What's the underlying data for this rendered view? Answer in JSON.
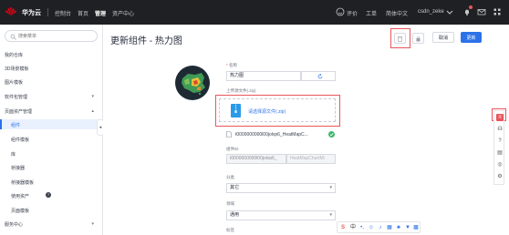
{
  "topbar": {
    "brand": "华为云",
    "nav": [
      "控制台",
      "首页",
      "管理",
      "资产中心"
    ],
    "right": [
      "评价",
      "工单",
      "简体中文",
      "csdn_zeke"
    ],
    "colors": {
      "bg": "#1f2023",
      "logo": "#e60012"
    }
  },
  "sidebar": {
    "search_placeholder": "搜索菜单",
    "items": [
      {
        "label": "我的仓库"
      },
      {
        "label": "3D场景模板"
      },
      {
        "label": "图片模板"
      },
      {
        "label": "软件包管理"
      },
      {
        "label": "页面资产管理"
      },
      {
        "label": "组件"
      },
      {
        "label": "组件模板"
      },
      {
        "label": "库"
      },
      {
        "label": "桥接器"
      },
      {
        "label": "桥接器模板"
      },
      {
        "label": "使用资产"
      },
      {
        "label": "页面模板"
      },
      {
        "label": "服务中心"
      }
    ]
  },
  "main": {
    "title": "更新组件 - 热力图",
    "buttons": {
      "cancel": "取消",
      "update": "更新"
    },
    "form": {
      "name_label": "名称",
      "name_value": "热力图",
      "upload_label": "上传源文件(.zip)",
      "upload_text": "请选择源文件(.zip)",
      "file_name": "t0000000000l00jolvp6_HeatMapC...",
      "id_label": "组件ID",
      "id_value": "t0000000000l00jolvp6_",
      "id_suffix": "HeatMapChartMi",
      "category_label": "分类",
      "category_value": "其它",
      "domain_label": "领域",
      "domain_value": "通用",
      "tags_label": "标签"
    }
  },
  "colors": {
    "accent": "#2b72e8",
    "highlight": "#e8565c"
  }
}
